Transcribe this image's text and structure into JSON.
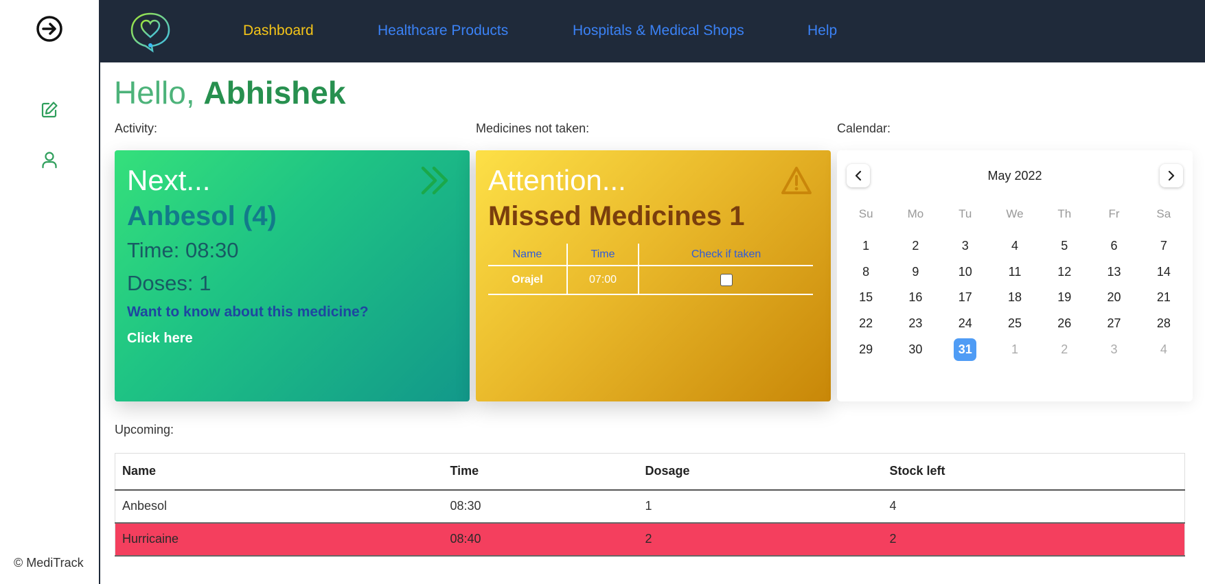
{
  "app": {
    "footer": "© MediTrack"
  },
  "nav": {
    "items": [
      {
        "label": "Dashboard",
        "active": true
      },
      {
        "label": "Healthcare Products",
        "active": false
      },
      {
        "label": "Hospitals & Medical Shops",
        "active": false
      },
      {
        "label": "Help",
        "active": false
      }
    ]
  },
  "greeting": {
    "hello": "Hello,",
    "name": "Abhishek"
  },
  "sections": {
    "activity": "Activity:",
    "missed": "Medicines not taken:",
    "calendar": "Calendar:",
    "upcoming": "Upcoming:"
  },
  "next_card": {
    "title": "Next...",
    "medicine": "Anbesol (4)",
    "time": "Time: 08:30",
    "doses": "Doses: 1",
    "question": "Want to know about this medicine?",
    "link": "Click here"
  },
  "attention_card": {
    "title": "Attention...",
    "headline": "Missed Medicines 1",
    "columns": [
      "Name",
      "Time",
      "Check if taken"
    ],
    "rows": [
      {
        "name": "Orajel",
        "time": "07:00",
        "taken": false
      }
    ]
  },
  "calendar": {
    "month": "May 2022",
    "weekdays": [
      "Su",
      "Mo",
      "Tu",
      "We",
      "Th",
      "Fr",
      "Sa"
    ],
    "weeks": [
      [
        "1",
        "2",
        "3",
        "4",
        "5",
        "6",
        "7"
      ],
      [
        "8",
        "9",
        "10",
        "11",
        "12",
        "13",
        "14"
      ],
      [
        "15",
        "16",
        "17",
        "18",
        "19",
        "20",
        "21"
      ],
      [
        "22",
        "23",
        "24",
        "25",
        "26",
        "27",
        "28"
      ],
      [
        "29",
        "30",
        "31",
        "1",
        "2",
        "3",
        "4"
      ]
    ],
    "selected": "31"
  },
  "upcoming": {
    "columns": [
      "Name",
      "Time",
      "Dosage",
      "Stock left"
    ],
    "rows": [
      {
        "name": "Anbesol",
        "time": "08:30",
        "dosage": "1",
        "stock": "4",
        "highlight": false
      },
      {
        "name": "Hurricaine",
        "time": "08:40",
        "dosage": "2",
        "stock": "2",
        "highlight": true
      }
    ]
  },
  "colors": {
    "topbar": "#1f2a3a",
    "nav_active": "#f5c518",
    "nav_link": "#3b82f6",
    "greeting": "#27904f",
    "highlight_row": "#f43f5e",
    "calendar_selected": "#4f9cf5"
  },
  "icons": {
    "logout": "arrow-right-circle-icon",
    "edit": "edit-icon",
    "user": "user-icon",
    "logo": "heart-chat-logo",
    "next": "double-chevron-right-icon",
    "warning": "warning-triangle-icon",
    "prev_month": "chevron-left-icon",
    "next_month": "chevron-right-icon"
  }
}
